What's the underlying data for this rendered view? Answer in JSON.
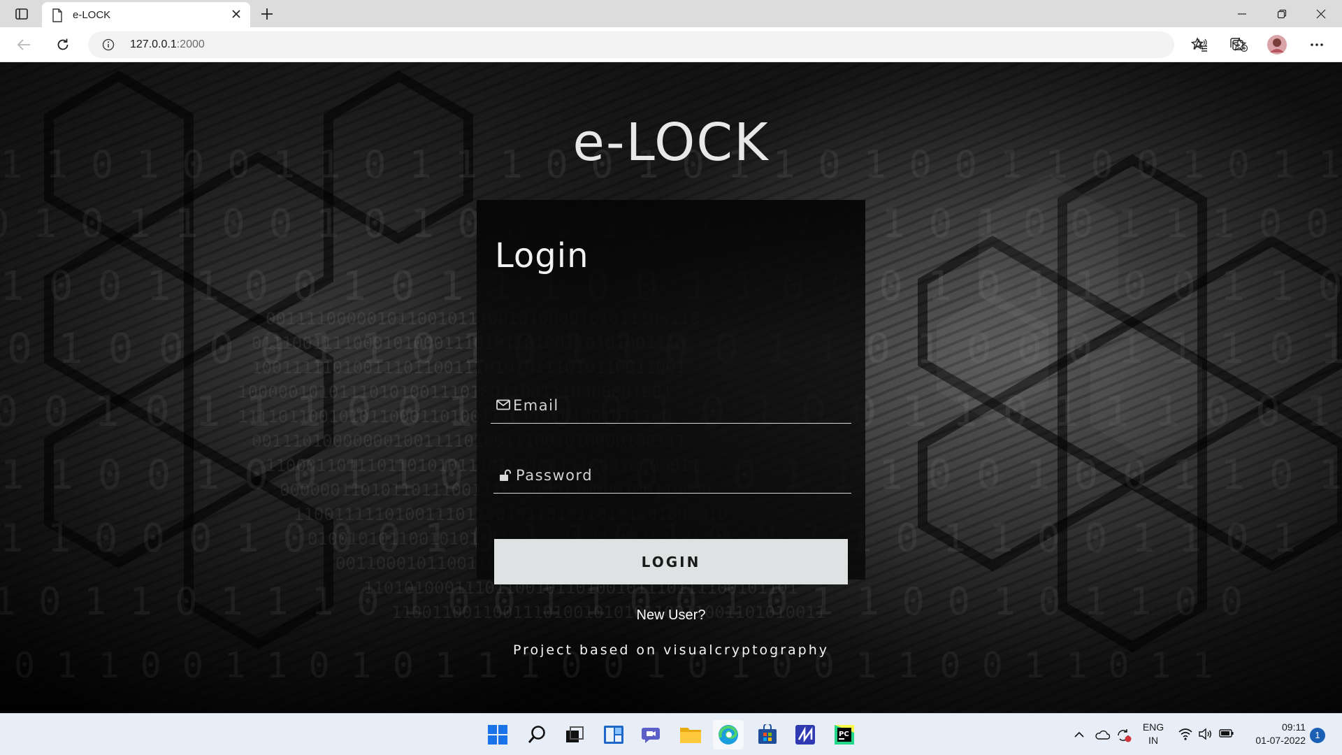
{
  "browser": {
    "tab_title": "e-LOCK",
    "url_host": "127.0.0.1",
    "url_port": ":2000"
  },
  "page": {
    "site_title": "e-LOCK",
    "login_heading": "Login",
    "email_placeholder": "Email",
    "password_placeholder": "Password",
    "login_button": "LOGIN",
    "new_user_link": "New User?",
    "footer": "Project based on visualcryptography"
  },
  "taskbar": {
    "apps": [
      "start-icon",
      "search-icon",
      "task-view-icon",
      "widgets-icon",
      "chat-icon",
      "file-explorer-icon",
      "edge-icon",
      "store-icon",
      "vscode-icon",
      "pycharm-icon"
    ],
    "language_line1": "ENG",
    "language_line2": "IN",
    "time": "09:11",
    "date": "01-07-2022",
    "notification_count": "1"
  },
  "colors": {
    "accent": "#1a5fb4",
    "button_bg": "#dfe2e3",
    "card_bg": "#0a0a0a"
  }
}
